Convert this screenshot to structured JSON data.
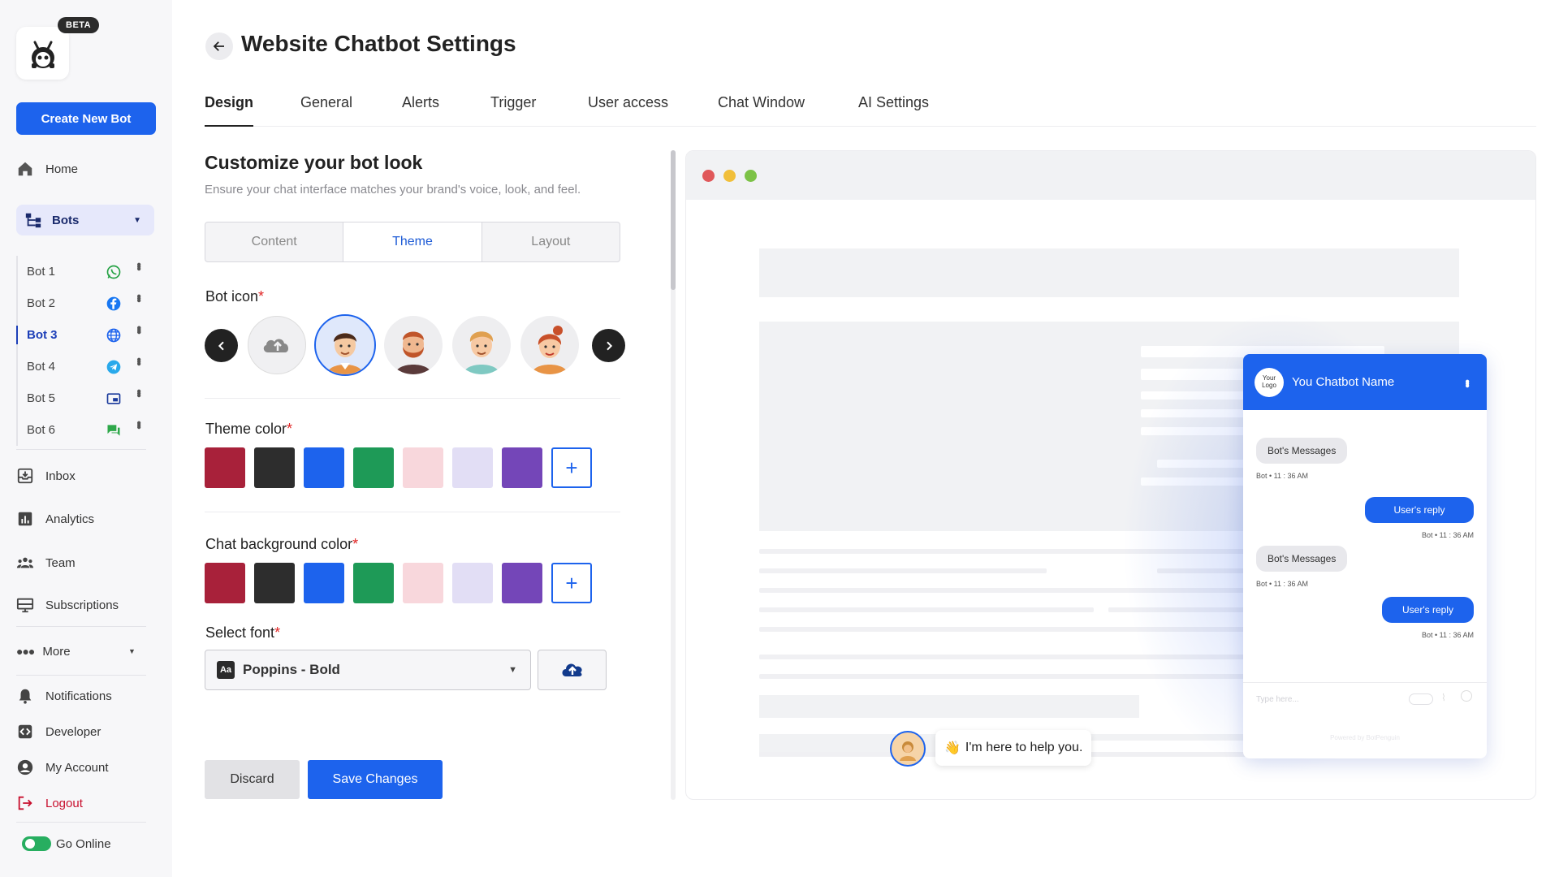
{
  "app": {
    "beta_badge": "BETA",
    "create_button": "Create New Bot"
  },
  "sidebar": {
    "home": "Home",
    "bots": "Bots",
    "bot_list": [
      {
        "label": "Bot 1",
        "channel_icon": "whatsapp-icon"
      },
      {
        "label": "Bot 2",
        "channel_icon": "facebook-icon"
      },
      {
        "label": "Bot 3",
        "channel_icon": "globe-icon",
        "active": true
      },
      {
        "label": "Bot 4",
        "channel_icon": "telegram-icon"
      },
      {
        "label": "Bot 5",
        "channel_icon": "window-icon"
      },
      {
        "label": "Bot 6",
        "channel_icon": "chat-icon"
      }
    ],
    "inbox": "Inbox",
    "analytics": "Analytics",
    "team": "Team",
    "subscriptions": "Subscriptions",
    "more": "More",
    "notifications": "Notifications",
    "developer": "Developer",
    "my_account": "My Account",
    "logout": "Logout",
    "go_online": "Go Online"
  },
  "header": {
    "title": "Website Chatbot Settings"
  },
  "tabs": [
    "Design",
    "General",
    "Alerts",
    "Trigger",
    "User access",
    "Chat Window",
    "AI Settings"
  ],
  "section": {
    "title": "Customize your bot look",
    "subtitle": "Ensure your chat interface matches your brand's voice, look, and feel.",
    "segments": [
      "Content",
      "Theme",
      "Layout"
    ],
    "active_segment": "Theme"
  },
  "form": {
    "bot_icon_label": "Bot icon",
    "theme_color_label": "Theme color",
    "chat_bg_label": "Chat background color",
    "font_label": "Select font",
    "required_mark": "*",
    "font_value": "Poppins - Bold",
    "font_icon_text": "Aa",
    "add_symbol": "+",
    "colors": [
      "#a8213a",
      "#2d2d2d",
      "#1d63ed",
      "#1e9a57",
      "#f8d7dc",
      "#e2def5",
      "#7446b8"
    ]
  },
  "actions": {
    "discard": "Discard",
    "save": "Save Changes"
  },
  "preview": {
    "chat_name": "You Chatbot Name",
    "logo_text": "Your Logo",
    "messages": [
      {
        "from": "bot",
        "text": "Bot's Messages",
        "meta": "Bot • 11 : 36 AM"
      },
      {
        "from": "user",
        "text": "User's reply",
        "meta": "Bot • 11 : 36 AM"
      },
      {
        "from": "bot",
        "text": "Bot's Messages",
        "meta": "Bot • 11 : 36 AM"
      },
      {
        "from": "user",
        "text": "User's reply",
        "meta": "Bot • 11 : 36 AM"
      }
    ],
    "input_placeholder": "Type here...",
    "powered_by": "Powered by BotPenguin",
    "greeting": "I'm here to help you.",
    "greeting_emoji": "👋"
  }
}
